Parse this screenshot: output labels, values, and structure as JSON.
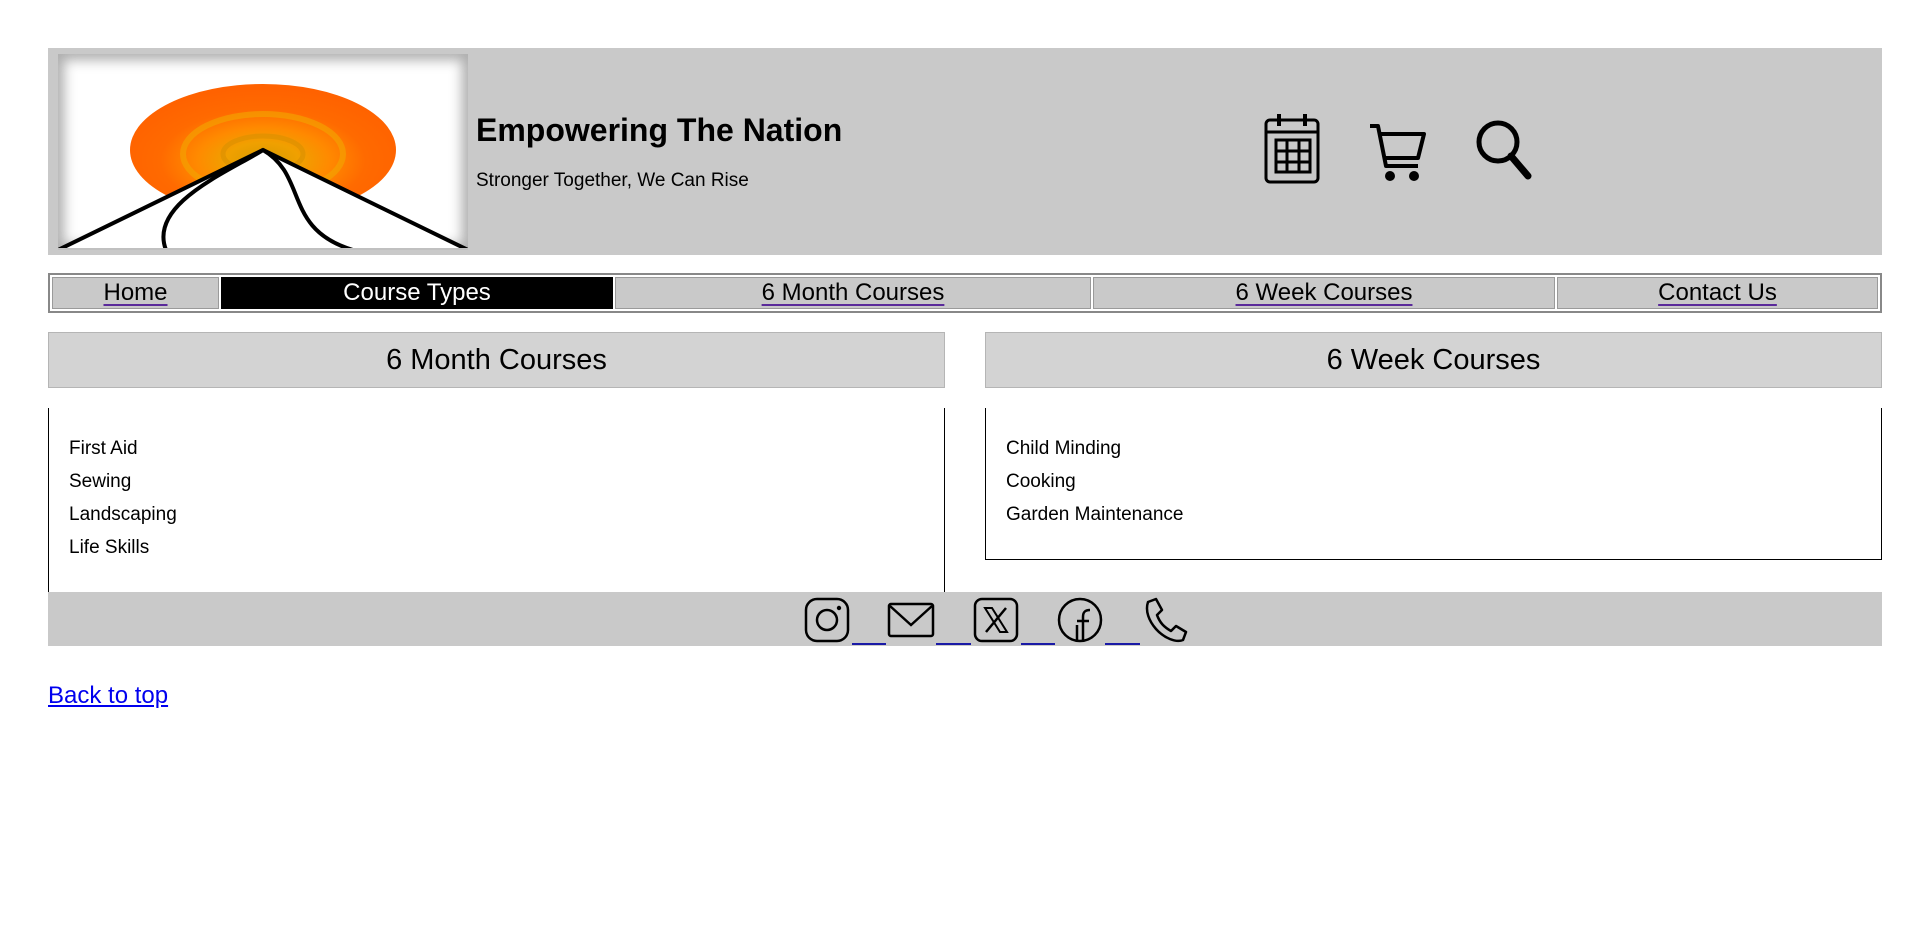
{
  "header": {
    "title": "Empowering The Nation",
    "tagline": "Stronger Together, We Can Rise",
    "logo_icon": "sunrise-mountain-logo",
    "icons": [
      "calendar-icon",
      "cart-icon",
      "search-icon"
    ]
  },
  "nav": {
    "items": [
      {
        "label": "Home"
      },
      {
        "label": "Course Types"
      },
      {
        "label": "6 Month Courses"
      },
      {
        "label": "6 Week Courses"
      },
      {
        "label": "Contact Us"
      }
    ],
    "active_item": "Course Types"
  },
  "six_month": {
    "heading": "6 Month Courses",
    "courses": [
      "First Aid",
      "Sewing",
      "Landscaping",
      "Life Skills"
    ]
  },
  "six_week": {
    "heading": "6 Week Courses",
    "courses": [
      "Child Minding",
      "Cooking",
      "Garden Maintenance"
    ]
  },
  "footer": {
    "social_icons": [
      "instagram-icon",
      "email-icon",
      "x-icon",
      "facebook-icon",
      "phone-icon"
    ]
  },
  "back_to_top": "Back to top",
  "colors": {
    "header_bg": "#c9c9c9",
    "heading_bg": "#d3d3d3",
    "active_nav_bg": "#000000",
    "link": "#0000ee",
    "sun_orange": "#ff6a00"
  }
}
